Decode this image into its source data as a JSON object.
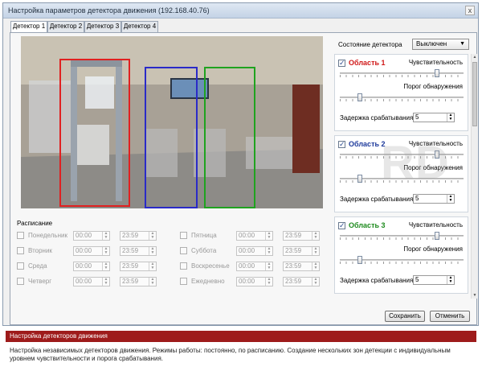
{
  "window": {
    "title": "Настройка параметров детектора движения (192.168.40.76)",
    "close_glyph": "x"
  },
  "tabs": [
    "Детектор 1",
    "Детектор 2",
    "Детектор 3",
    "Детектор 4"
  ],
  "active_tab": "Детектор 1",
  "camera": {
    "zones_overlay": [
      {
        "name": "Область 1",
        "color": "#e02020"
      },
      {
        "name": "Область 2",
        "color": "#2a2ac8"
      },
      {
        "name": "Область 3",
        "color": "#1fa31f"
      }
    ]
  },
  "schedule": {
    "label": "Расписание",
    "days": [
      {
        "name": "Понедельник",
        "from": "00:00",
        "to": "23:59"
      },
      {
        "name": "Вторник",
        "from": "00:00",
        "to": "23:59"
      },
      {
        "name": "Среда",
        "from": "00:00",
        "to": "23:59"
      },
      {
        "name": "Четверг",
        "from": "00:00",
        "to": "23:59"
      },
      {
        "name": "Пятница",
        "from": "00:00",
        "to": "23:59"
      },
      {
        "name": "Суббота",
        "from": "00:00",
        "to": "23:59"
      },
      {
        "name": "Воскресенье",
        "from": "00:00",
        "to": "23:59"
      },
      {
        "name": "Ежедневно",
        "from": "00:00",
        "to": "23:59"
      }
    ]
  },
  "detector_state": {
    "label": "Состояние детектора",
    "value": "Выключен"
  },
  "zones": [
    {
      "name": "Область 1",
      "color": "#d01818",
      "checked": true,
      "sensitivity_label": "Чувствительность",
      "sensitivity": 0.8,
      "threshold_label": "Порог обнаружения",
      "threshold": 0.15,
      "delay_label": "Задержка срабатывания",
      "delay": "5"
    },
    {
      "name": "Область 2",
      "color": "#1e3a9c",
      "checked": true,
      "sensitivity_label": "Чувствительность",
      "sensitivity": 0.8,
      "threshold_label": "Порог обнаружения",
      "threshold": 0.15,
      "delay_label": "Задержка срабатывания",
      "delay": "5"
    },
    {
      "name": "Область 3",
      "color": "#1d8a1d",
      "checked": true,
      "sensitivity_label": "Чувствительность",
      "sensitivity": 0.8,
      "threshold_label": "Порог обнаружения",
      "threshold": 0.15,
      "delay_label": "Задержка срабатывания",
      "delay": "5"
    }
  ],
  "buttons": {
    "save": "Сохранить",
    "cancel": "Отменить"
  },
  "caption": {
    "heading": "Настройка детекторов движения",
    "text": "Настройка независимых детекторов движения.  Режимы работы: постоянно, по расписанию. Создание нескольких зон детекции с индивидуальным уровнем чувствительности и порога срабатывания."
  },
  "watermark": "RD"
}
